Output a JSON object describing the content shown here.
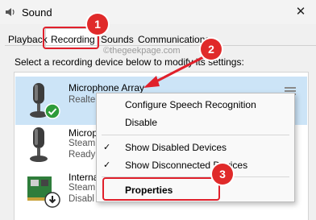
{
  "window": {
    "title": "Sound",
    "close_glyph": "✕"
  },
  "tabs": [
    {
      "label": "Playback"
    },
    {
      "label": "Recording"
    },
    {
      "label": "Sounds"
    },
    {
      "label": "Communications"
    }
  ],
  "instruction": "Select a recording device below to modify its settings:",
  "watermark": "©thegeekpage.com",
  "devices": [
    {
      "name": "Microphone Array",
      "sub1": "Realte",
      "sub2": "",
      "status_icon": "green-check-icon",
      "selected": true
    },
    {
      "name": "Microp",
      "sub1": "Steam",
      "sub2": "Ready",
      "status_icon": "none",
      "selected": false
    },
    {
      "name": "Interna",
      "sub1": "Steam",
      "sub2": "Disabl",
      "status_icon": "down-arrow-icon",
      "selected": false
    }
  ],
  "context_menu": {
    "items": [
      {
        "label": "Configure Speech Recognition",
        "checked": false,
        "bold": false
      },
      {
        "label": "Disable",
        "checked": false,
        "bold": false
      },
      {
        "label": "Show Disabled Devices",
        "checked": true,
        "bold": false
      },
      {
        "label": "Show Disconnected Devices",
        "checked": true,
        "bold": false
      },
      {
        "label": "Properties",
        "checked": false,
        "bold": true
      }
    ],
    "check_glyph": "✓"
  },
  "annotations": [
    {
      "number": "1"
    },
    {
      "number": "2"
    },
    {
      "number": "3"
    }
  ],
  "colors": {
    "accent_red": "#e0202b",
    "selection": "#cce4f7",
    "check_green": "#2e9b3a"
  }
}
